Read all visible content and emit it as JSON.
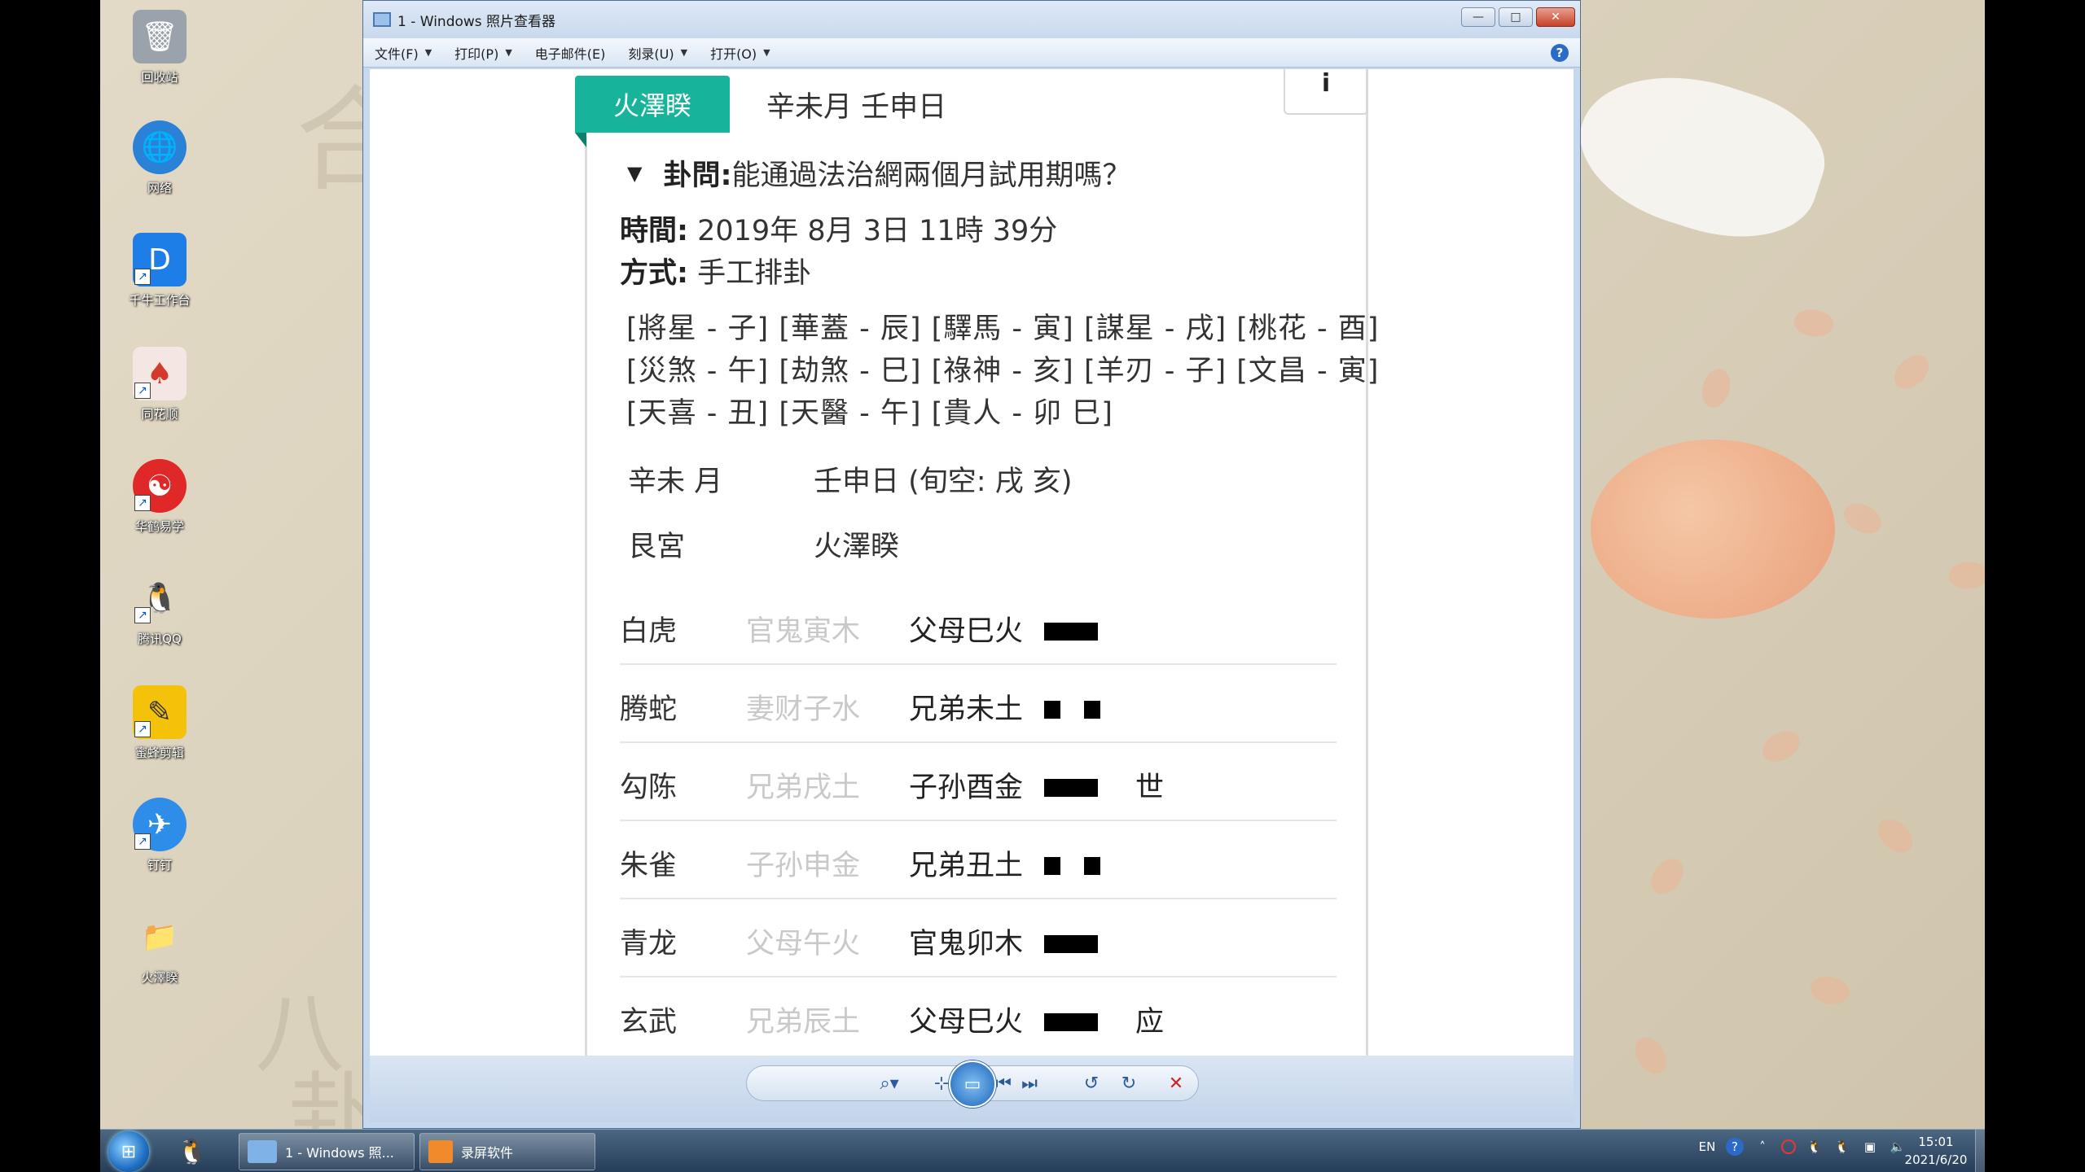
{
  "desktop": {
    "icons": [
      {
        "label": "回收站",
        "icon": "recycle-bin-icon",
        "color": "#9aa3ab",
        "glyph": "🗑"
      },
      {
        "label": "网络",
        "icon": "network-globe-icon",
        "color": "#2a82d6",
        "glyph": "🌐"
      },
      {
        "label": "千牛工作台",
        "icon": "qianniu-icon",
        "color": "#1e7ee8",
        "glyph": "D"
      },
      {
        "label": "同花顺",
        "icon": "tonghuashun-cards-icon",
        "color": "#d33a2c",
        "glyph": "♠"
      },
      {
        "label": "华鹤易学",
        "icon": "yinyang-icon",
        "color": "#e02828",
        "glyph": "☯"
      },
      {
        "label": "腾讯QQ",
        "icon": "qq-penguin-icon",
        "color": "#222",
        "glyph": "🐧"
      },
      {
        "label": "蜜蜂剪辑",
        "icon": "bee-editor-icon",
        "color": "#f5c20a",
        "glyph": "✎"
      },
      {
        "label": "钉钉",
        "icon": "dingtalk-icon",
        "color": "#2d8de8",
        "glyph": "✈"
      },
      {
        "label": "火澤睽",
        "icon": "folder-icon",
        "color": "#d9b75a",
        "glyph": "📁"
      }
    ]
  },
  "window": {
    "title": "1 - Windows 照片查看器",
    "controls": {
      "minimize": "—",
      "maximize": "□",
      "close": "✕"
    },
    "menu": [
      "文件(F)",
      "打印(P)",
      "电子邮件(E)",
      "刻录(U)",
      "打开(O)"
    ],
    "help": "?"
  },
  "content": {
    "tab_label": "火澤睽",
    "tab_date": "辛未月 壬申日",
    "info": "i",
    "question_label": "卦問:",
    "question_text": " 能通過法治網兩個月試用期嗎？",
    "time_label": "時間:",
    "time_value": " 2019年 8月 3日 11時 39分",
    "method_label": "方式:",
    "method_value": " 手工排卦",
    "shensha": [
      "[將星 - 子] [華蓋 - 辰] [驛馬 - 寅] [謀星 - 戌] [桃花 - 酉]",
      "[災煞 - 午] [劫煞 - 巳] [祿神 - 亥] [羊刃 - 子] [文昌 - 寅]",
      "[天喜 - 丑] [天醫 - 午] [貴人 - 卯 巳]"
    ],
    "month": "辛未 月",
    "day": "壬申日 (旬空: 戌 亥)",
    "palace": "艮宮",
    "gua_name": "火澤睽",
    "yao": [
      {
        "god": "白虎",
        "hidden": "官鬼寅木",
        "main": "父母巳火",
        "line": "yang",
        "mark": ""
      },
      {
        "god": "腾蛇",
        "hidden": "妻财子水",
        "main": "兄弟未土",
        "line": "yin",
        "mark": ""
      },
      {
        "god": "勾陈",
        "hidden": "兄弟戌土",
        "main": "子孙酉金",
        "line": "yang",
        "mark": "世"
      },
      {
        "god": "朱雀",
        "hidden": "子孙申金",
        "main": "兄弟丑土",
        "line": "yin",
        "mark": ""
      },
      {
        "god": "青龙",
        "hidden": "父母午火",
        "main": "官鬼卯木",
        "line": "yang",
        "mark": ""
      },
      {
        "god": "玄武",
        "hidden": "兄弟辰土",
        "main": "父母巳火",
        "line": "yang",
        "mark": "应"
      }
    ]
  },
  "toolbar": {
    "zoom": "⌕▾",
    "fit": "⊹",
    "prev": "⏮",
    "slideshow": "▭",
    "next": "⏭",
    "rotate_ccw": "↺",
    "rotate_cw": "↻",
    "delete": "✕"
  },
  "taskbar": {
    "start": "⊞",
    "pinned_qq": "🐧",
    "tasks": [
      {
        "label": "1 - Windows 照...",
        "icon_color": "#7fb2e6"
      },
      {
        "label": "录屏软件",
        "icon_color": "#f08a2a"
      }
    ],
    "tray_lang": "EN",
    "time": "15:01",
    "date": "2021/6/20"
  },
  "colors": {
    "accent": "#17b39a",
    "accent_dark": "#0d7f6b",
    "window_frame": "#c6d8ee"
  }
}
